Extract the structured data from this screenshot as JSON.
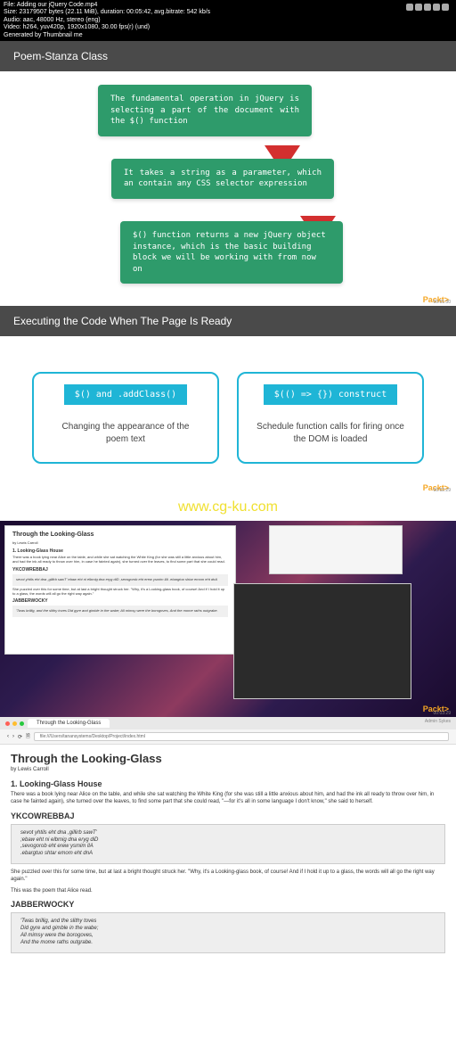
{
  "meta": {
    "filename": "File: Adding our jQuery Code.mp4",
    "size": "Size: 23179507 bytes (22.11 MiB), duration: 00:05:42, avg.bitrate: 542 kb/s",
    "audio": "Audio: aac, 48000 Hz, stereo (eng)",
    "video": "Video: h264, yuv420p, 1920x1080, 30.00 fps(r) (und)",
    "generated": "Generated by Thumbnail me"
  },
  "slide1": {
    "title": "Poem-Stanza Class",
    "box1": "The fundamental operation in jQuery is selecting a part of the document with the $() function",
    "box2": "It takes a string as a parameter, which an contain any CSS selector expression",
    "box3": "$() function returns a new jQuery object instance, which is the basic building block we will be working with from now on",
    "brand": "Packt",
    "ts": "00:01:30"
  },
  "slide2": {
    "title": "Executing the Code When The Page Is Ready",
    "card1": {
      "btn": "$() and .addClass()",
      "text": "Changing the appearance of the poem text"
    },
    "card2": {
      "btn": "$(() => {}) construct",
      "text": "Schedule function calls for firing once the DOM is loaded"
    },
    "brand": "Packt",
    "ts": "00:02:29"
  },
  "watermark": "www.cg-ku.com",
  "desktop": {
    "brand": "Packt",
    "ts": "00:03:29",
    "browser": {
      "title": "Through the Looking-Glass",
      "author": "by Lewis Carroll",
      "h1": "1. Looking-Glass House",
      "para1": "There was a book lying near Alice on the table, and while she sat watching the White King (for she was still a little anxious about him, and had the ink all ready to throw over him, in case he fainted again), she turned over the leaves, to find some part that she could read.",
      "yk": "YKCOWREBBAJ",
      "poem1": "sevot yhtils eht dna ,gillirb sawT' ebaw eht ni elbmig dna eryg diD ,sevogorob eht erew ysmim llA .ebargtuo shtar emom eht dnA",
      "para2": "She puzzled over this for some time, but at last a bright thought struck her. \"Why, it's a Looking-glass book, of course! And if I hold it up to a glass, the words will all go the right way again.\"",
      "jb": "JABBERWOCKY",
      "poem2": "'Twas brillig, and the slithy toves Did gyre and gimble in the wabe; All mimsy were the borogoves, And the mome raths outgrabe."
    }
  },
  "browser": {
    "tab": "Through the Looking-Glass",
    "admin": "Admin Sykes",
    "url": "file:///Users/tanansystems/Desktop/Project/index.html",
    "title": "Through the Looking-Glass",
    "author": "by Lewis Carroll",
    "h1": "1. Looking-Glass House",
    "para1": "There was a book lying near Alice on the table, and while she sat watching the White King (for she was still a little anxious about him, and had the ink all ready to throw over him, in case he fainted again), she turned over the leaves, to find some part that she could read, \"—for it's all in some language I don't know,\" she said to herself.",
    "yk": "YKCOWREBBAJ",
    "poem1a": "sevot yhtils eht dna ,gillirb sawT'",
    "poem1b": ";ebaw eht ni elbmig dna eryg diD",
    "poem1c": ",sevogorob eht erew ysmim llA",
    "poem1d": ".ebargtuo shtar emom eht dnA",
    "para2": "She puzzled over this for some time, but at last a bright thought struck her. \"Why, it's a Looking-glass book, of course! And if I hold it up to a glass, the words will all go the right way again.\"",
    "para3": "This was the poem that Alice read.",
    "jb": "JABBERWOCKY",
    "poem2a": "'Twas brillig, and the slithy toves",
    "poem2b": "Did gyre and gimble in the wabe;",
    "poem2c": "All mimsy were the borogoves,",
    "poem2d": "And the mome raths outgrabe."
  }
}
